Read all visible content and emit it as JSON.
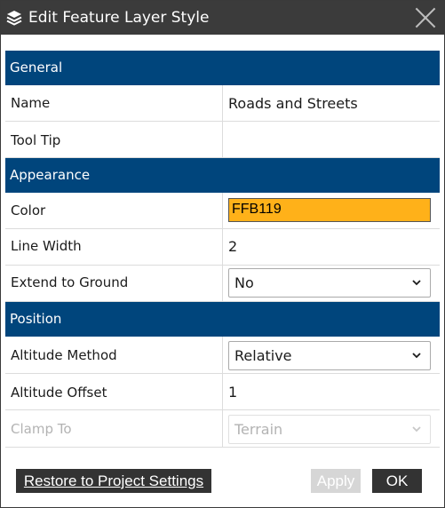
{
  "dialog": {
    "title": "Edit Feature Layer Style"
  },
  "sections": {
    "general": "General",
    "appearance": "Appearance",
    "position": "Position"
  },
  "fields": {
    "name": {
      "label": "Name",
      "value": "Roads and Streets"
    },
    "tooltip": {
      "label": "Tool Tip",
      "value": ""
    },
    "color": {
      "label": "Color",
      "value": "FFB119",
      "swatch": "#FFB119"
    },
    "line_width": {
      "label": "Line Width",
      "value": "2"
    },
    "extend_to_ground": {
      "label": "Extend to Ground",
      "value": "No"
    },
    "altitude_method": {
      "label": "Altitude Method",
      "value": "Relative"
    },
    "altitude_offset": {
      "label": "Altitude Offset",
      "value": "1"
    },
    "clamp_to": {
      "label": "Clamp To",
      "value": "Terrain",
      "disabled": true
    }
  },
  "buttons": {
    "restore": "Restore to Project Settings",
    "apply": "Apply",
    "ok": "OK"
  },
  "colors": {
    "titlebar": "#3B3B3B",
    "section_header": "#00457C",
    "button_dark": "#333333",
    "button_disabled": "#D6D6D6"
  },
  "icons": {
    "title": "layers-icon",
    "close": "close-icon",
    "dropdown": "chevron-down-icon"
  }
}
